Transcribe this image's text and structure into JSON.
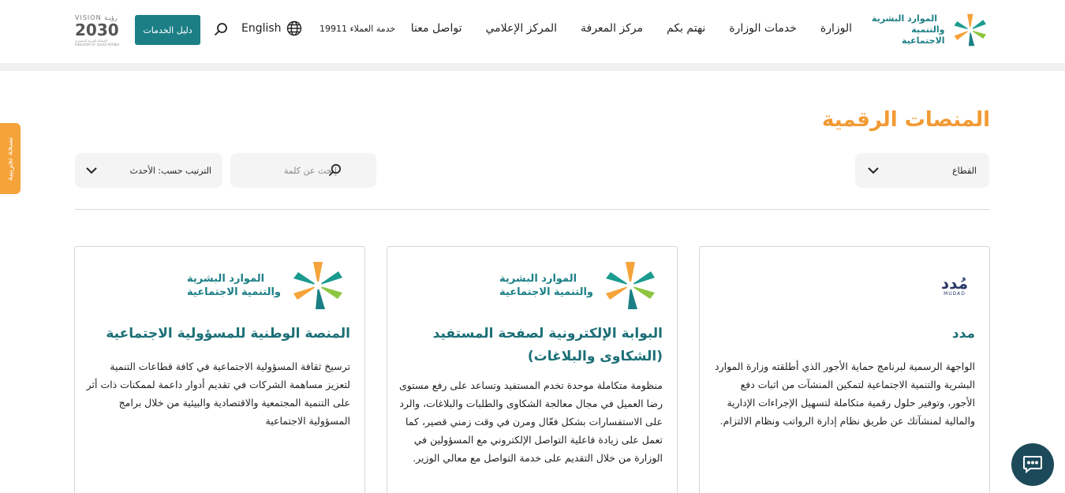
{
  "header": {
    "logo_line1": "الموارد البشرية",
    "logo_line2": "والتنمية الاجتماعية",
    "nav": [
      "الوزارة",
      "خدمات الوزارة",
      "نهتم بكم",
      "مركز المعرفة",
      "المركز الإعلامي",
      "تواصل معنا"
    ],
    "customer_service": "خدمة العملاء 19911",
    "language": "English",
    "services_button": "دليل الخدمات",
    "vision_top": "VISION رؤيـة",
    "vision_num": "2030",
    "vision_sub": "المملكة العربية السعودية KINGDOM OF SAUDI ARABIA"
  },
  "side_tab": "نسخة تجريبية",
  "page_title": "المنصات الرقمية",
  "filters": {
    "sector_label": "القطاع",
    "search_placeholder": "إبحث عن كلمة",
    "sort_label": "الترتيب حسب: الأحدث"
  },
  "cards": [
    {
      "logo_type": "mudad",
      "logo_text": "مُدد",
      "logo_sub": "MUDAD",
      "title": "مدد",
      "description": "الواجهة الرسمية لبرنامج حماية الأجور الذي أطلقته وزارة الموارد البشرية والتنمية الاجتماعية لتمكين المنشآت من اثبات دفع الأجور، وتوفير حلول رقمية متكاملة لتسهيل الإجراءات الإدارية والمالية لمنشآتك عن طريق نظام إدارة الرواتب ونظام الالتزام."
    },
    {
      "logo_type": "ministry",
      "logo_line1": "الموارد البشرية",
      "logo_line2": "والتنمية الاجتماعية",
      "title": "البوابة الإلكترونية لصفحة المستفيد (الشكاوى والبلاغات)",
      "description": "منظومة متكاملة موحدة تخدم المستفيد وتساعد على رفع مستوى رضا العميل في مجال معالجة الشكاوى والطلبات والبلاغات، والرد على الاستفسارات بشكل فعّال ومرن في وقت زمني قصير، كما تعمل على زيادة فاعلية التواصل الإلكتروني مع المسؤولين في الوزارة من خلال التقديم على خدمة التواصل مع معالي الوزير."
    },
    {
      "logo_type": "ministry",
      "logo_line1": "الموارد البشرية",
      "logo_line2": "والتنمية الاجتماعية",
      "title": "المنصة الوطنية للمسؤولية الاجتماعية",
      "description": "ترسيخ ثقافة المسؤولية الاجتماعية في كافة قطاعات التنمية لتعزيز مساهمة الشركات في تقديم أدوار داعمة لممكنات ذات أثر على التنمية المجتمعية والاقتصادية والبيئية من خلال برامج المسؤولية الاجتماعية"
    }
  ],
  "colors": {
    "primary": "#1b7f85",
    "accent": "#f29a34",
    "title_teal": "#1b6f76"
  }
}
